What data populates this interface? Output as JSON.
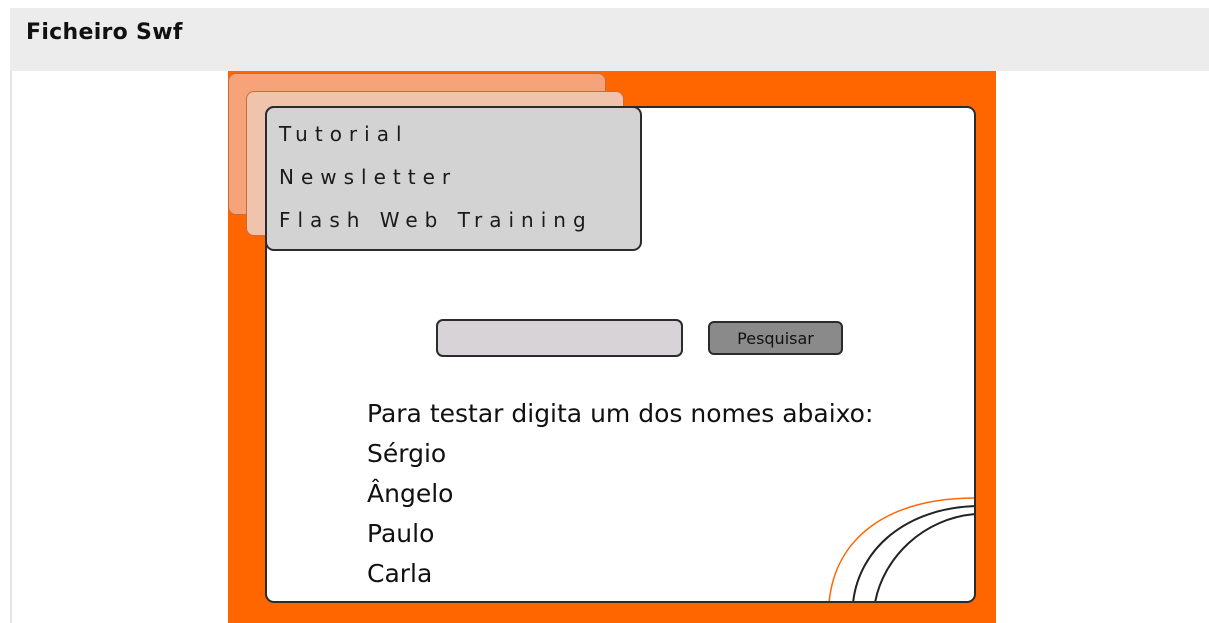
{
  "page": {
    "title": "Ficheiro Swf"
  },
  "flash": {
    "menu": {
      "items": [
        "Tutorial",
        "Newsletter",
        "Flash Web Training"
      ]
    },
    "search": {
      "value": "",
      "placeholder": "",
      "button_label": "Pesquisar"
    },
    "instructions": {
      "heading": "Para testar digita um dos nomes abaixo:",
      "names": [
        "Sérgio",
        "Ângelo",
        "Paulo",
        "Carla"
      ]
    }
  },
  "colors": {
    "stage_orange": "#ff6600",
    "header_bar": "#ececec",
    "menu_panel": "#d3d3d3",
    "input_fill": "#d7d3d7",
    "button_fill": "#8a8a8a"
  }
}
